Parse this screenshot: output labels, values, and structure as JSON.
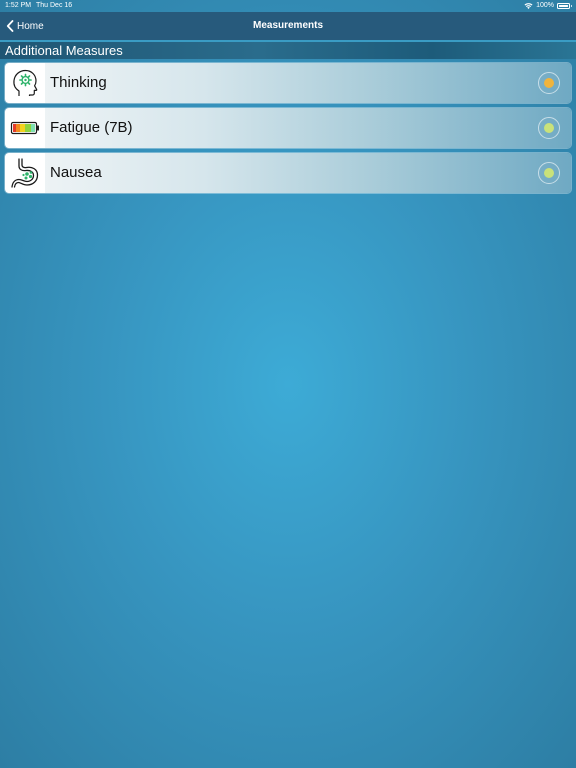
{
  "statusbar": {
    "time": "1:52 PM",
    "date": "Thu Dec 16",
    "battery": "100%"
  },
  "navbar": {
    "back_label": "Home",
    "title": "Measurements"
  },
  "section": {
    "title": "Additional Measures"
  },
  "items": [
    {
      "label": "Thinking",
      "icon": "head-gear-icon",
      "indicator_color": "#f0b43c"
    },
    {
      "label": "Fatigue (7B)",
      "icon": "battery-level-icon",
      "indicator_color": "#c9e27a"
    },
    {
      "label": "Nausea",
      "icon": "stomach-icon",
      "indicator_color": "#c9e27a"
    }
  ],
  "colors": {
    "background": "#3795c0",
    "navbar": "#275a7c",
    "icon_accent": "#2fb36b"
  }
}
